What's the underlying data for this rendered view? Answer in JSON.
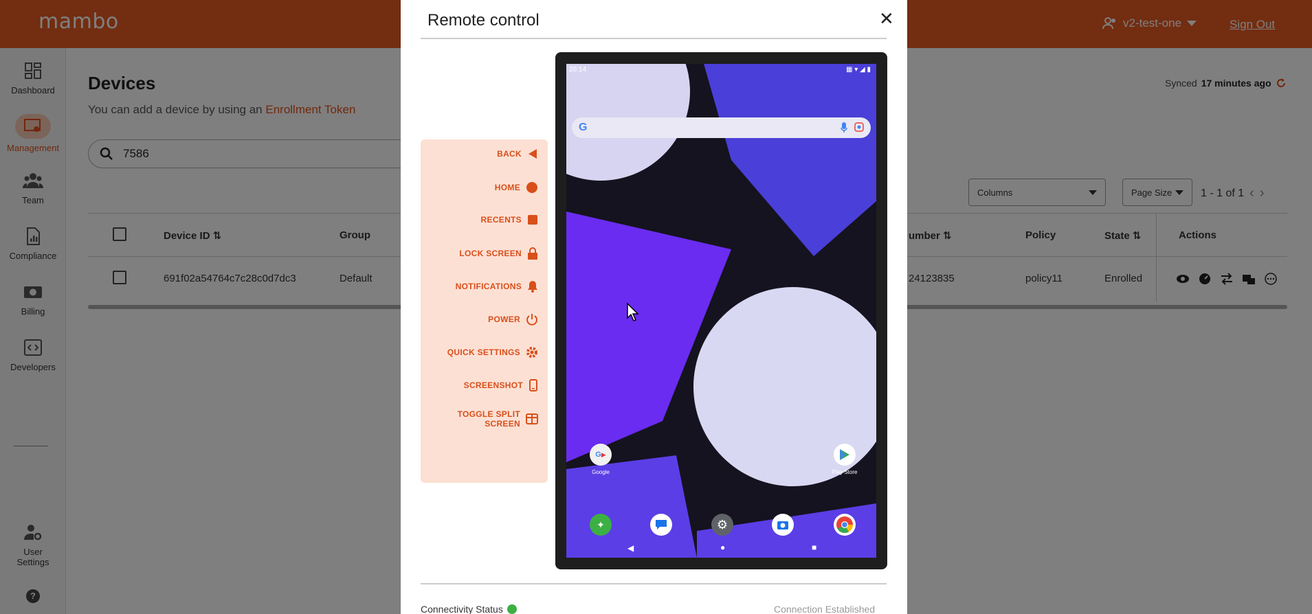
{
  "app": {
    "logo": "mambo"
  },
  "topbar": {
    "user": "v2-test-one",
    "signout": "Sign Out"
  },
  "sidebar": {
    "items": [
      {
        "label": "Dashboard",
        "icon": "dashboard-icon"
      },
      {
        "label": "Management",
        "icon": "management-icon",
        "active": true
      },
      {
        "label": "Team",
        "icon": "team-icon"
      },
      {
        "label": "Compliance",
        "icon": "compliance-icon"
      },
      {
        "label": "Billing",
        "icon": "billing-icon"
      },
      {
        "label": "Developers",
        "icon": "developers-icon"
      }
    ],
    "user_settings_line1": "User",
    "user_settings_line2": "Settings",
    "help": "?"
  },
  "devices": {
    "title": "Devices",
    "subtitle_prefix": "You can add a device by using an",
    "subtitle_link": "Enrollment Token",
    "synced_prefix": "Synced",
    "synced_value": "17 minutes ago",
    "search_value": "7586",
    "columns_label": "Columns",
    "page_size_label": "Page Size",
    "pagination": "1 - 1 of 1",
    "headers": {
      "device_id": "Device ID",
      "group": "Group",
      "number": "umber",
      "policy": "Policy",
      "state": "State",
      "actions": "Actions"
    },
    "rows": [
      {
        "device_id": "691f02a54764c7c28c0d7dc3",
        "group": "Default",
        "number": "24123835",
        "policy": "policy11",
        "state": "Enrolled"
      }
    ]
  },
  "modal": {
    "title": "Remote control",
    "close": "✕",
    "controls": {
      "back": "BACK",
      "home": "HOME",
      "recents": "RECENTS",
      "lock": "LOCK SCREEN",
      "notifications": "NOTIFICATIONS",
      "power": "POWER",
      "quick_settings": "QUICK SETTINGS",
      "screenshot": "SCREENSHOT",
      "split_line1": "TOGGLE SPLIT",
      "split_line2": "SCREEN"
    },
    "device_screen": {
      "status_time": "20:14",
      "app_google": "Google",
      "app_playstore": "Play Store"
    },
    "connectivity_label": "Connectivity Status",
    "connection_status": "Connection Established"
  },
  "colors": {
    "brand": "#e75a22",
    "accent": "#d94f1a",
    "panel": "#fde0d4",
    "connected": "#3cb043"
  }
}
